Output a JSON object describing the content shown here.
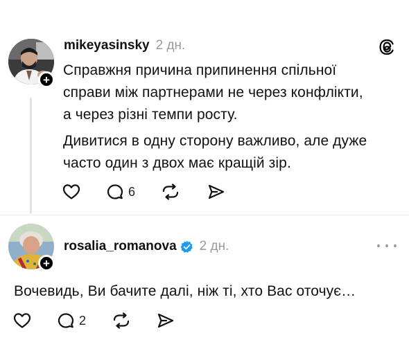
{
  "post": {
    "username": "mikeyasinsky",
    "time": "2 дн.",
    "text_lines": [
      "Справжня причина припинення спільної",
      "справи між партнерами не через конфлікти,",
      "а через різні темпи росту.",
      "Дивитися в одну сторону важливо, але дуже",
      "часто один з двох має кращій зір."
    ],
    "reply_count": "6",
    "platform_icon": "threads-logo-icon"
  },
  "reply": {
    "username": "rosalia_romanova",
    "time": "2 дн.",
    "verified": true,
    "text": "Вочевидь, Ви бачите далі, ніж ті, хто Вас оточує…",
    "reply_count": "2"
  },
  "colors": {
    "text": "#111111",
    "muted": "#9a9a9a",
    "verified": "#1d9bf0",
    "thread_line": "#e3e3e3"
  }
}
